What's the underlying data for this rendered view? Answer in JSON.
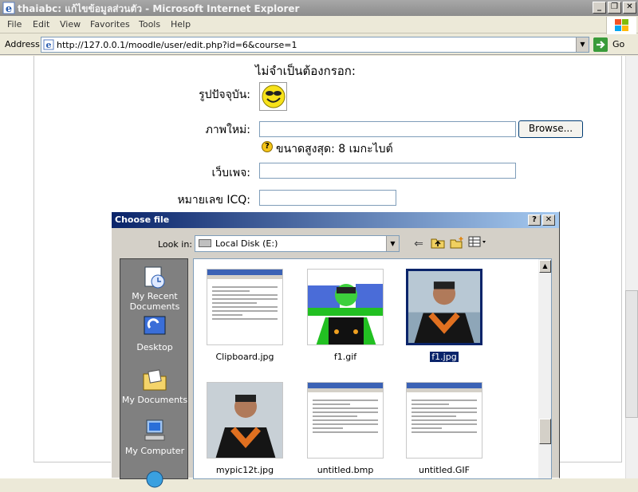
{
  "window": {
    "title": "thaiabc: แก้ไขข้อมูลส่วนตัว - Microsoft Internet Explorer"
  },
  "menu": [
    "File",
    "Edit",
    "View",
    "Favorites",
    "Tools",
    "Help"
  ],
  "address": {
    "label": "Address",
    "url": "http://127.0.0.1/moodle/user/edit.php?id=6&course=1",
    "go_label": "Go"
  },
  "form": {
    "section_title": "ไม่จำเป็นต้องกรอก:",
    "current_picture_label": "รูปปัจจุบัน:",
    "new_picture_label": "ภาพใหม่:",
    "new_picture_value": "",
    "browse_label": "Browse...",
    "max_size_text": "ขนาดสูงสุด: 8 เมกะไบต์",
    "webpage_label": "เว็บเพจ:",
    "webpage_value": "",
    "icq_label": "หมายเลข ICQ:",
    "icq_value": ""
  },
  "dialog": {
    "title": "Choose file",
    "help_label": "?",
    "close_label": "✕",
    "look_in_label": "Look in:",
    "look_in_value": "Local Disk (E:)",
    "places": [
      {
        "label": "My Recent Documents"
      },
      {
        "label": "Desktop"
      },
      {
        "label": "My Documents"
      },
      {
        "label": "My Computer"
      }
    ],
    "files": [
      {
        "name": "Clipboard.jpg",
        "kind": "screenshot",
        "selected": false
      },
      {
        "name": "f1.gif",
        "kind": "photo-gif",
        "selected": false
      },
      {
        "name": "f1.jpg",
        "kind": "photo",
        "selected": true
      },
      {
        "name": "mypic12t.jpg",
        "kind": "photo",
        "selected": false
      },
      {
        "name": "untitled.bmp",
        "kind": "screenshot",
        "selected": false
      },
      {
        "name": "untitled.GIF",
        "kind": "screenshot",
        "selected": false
      }
    ]
  },
  "colors": {
    "dialog_title": "#0a246a",
    "selection": "#0a246a",
    "go_green": "#3a9b3a"
  }
}
